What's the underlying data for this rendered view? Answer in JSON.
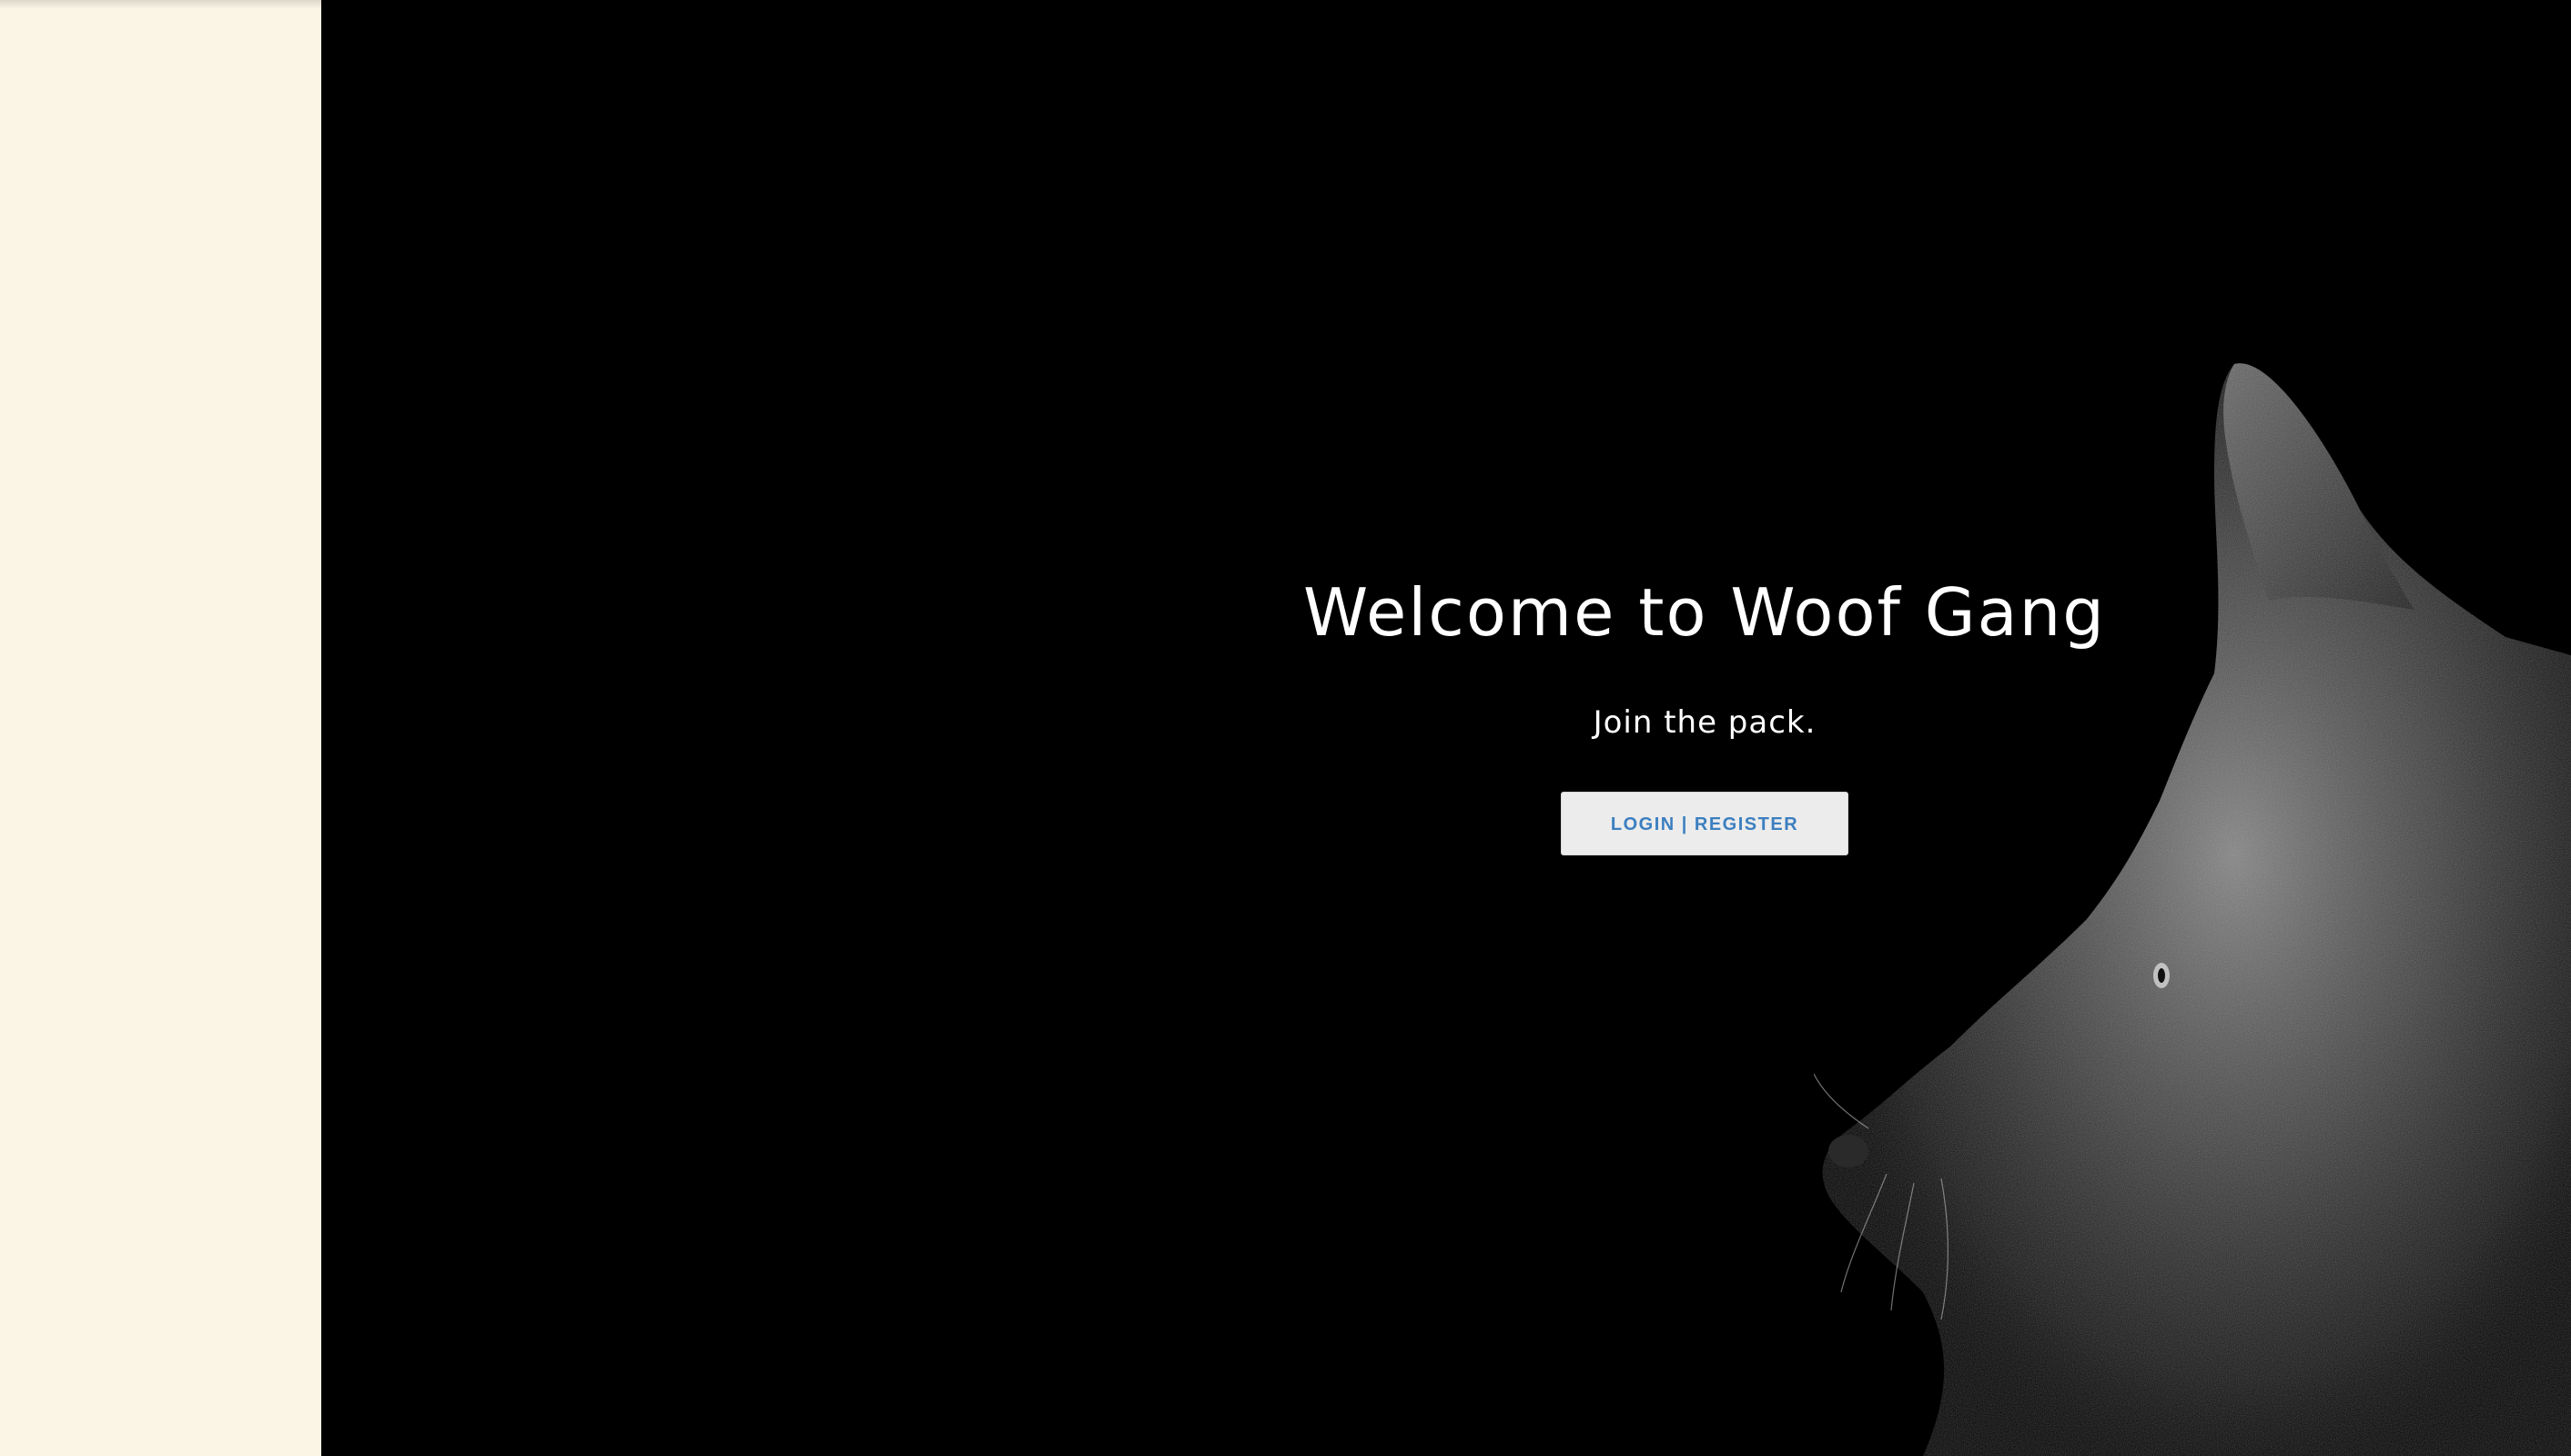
{
  "hero": {
    "title": "Welcome to Woof Gang",
    "subtitle": "Join the pack.",
    "login_button_label": "LOGIN | REGISTER"
  },
  "colors": {
    "left_panel_bg": "#fbf5e6",
    "hero_bg": "#000000",
    "button_bg": "#ececec",
    "button_text": "#3b7fc0",
    "title_text": "#ffffff"
  },
  "icons": {
    "hero_image": "dog-silhouette-image"
  }
}
